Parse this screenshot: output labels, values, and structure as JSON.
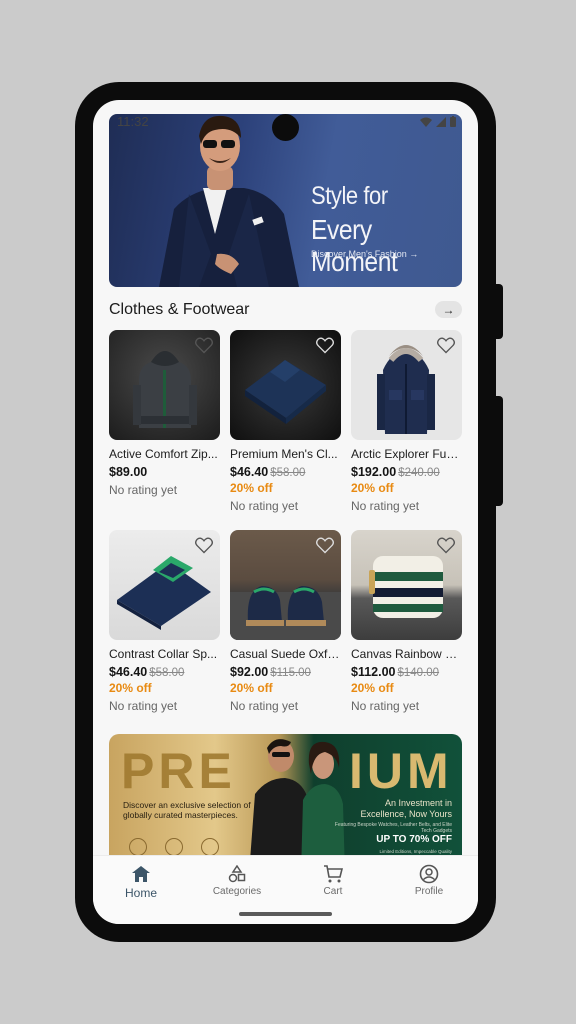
{
  "status": {
    "time": "11:32"
  },
  "hero": {
    "title_line1": "Style for",
    "title_line2": "Every Moment",
    "cta": "Discover Men's Fashion →"
  },
  "section": {
    "title": "Clothes & Footwear",
    "arrow": "→"
  },
  "products": [
    {
      "name": "Active Comfort Zip...",
      "price": "$89.00",
      "old_price": "",
      "discount": "",
      "rating": "No rating yet"
    },
    {
      "name": "Premium Men's Cl...",
      "price": "$46.40",
      "old_price": "$58.00",
      "discount": "20% off",
      "rating": "No rating yet"
    },
    {
      "name": "Arctic Explorer Fur-...",
      "price": "$192.00",
      "old_price": "$240.00",
      "discount": "20% off",
      "rating": "No rating yet"
    },
    {
      "name": "Contrast Collar Sp...",
      "price": "$46.40",
      "old_price": "$58.00",
      "discount": "20% off",
      "rating": "No rating yet"
    },
    {
      "name": "Casual Suede Oxfo...",
      "price": "$92.00",
      "old_price": "$115.00",
      "discount": "20% off",
      "rating": "No rating yet"
    },
    {
      "name": "Canvas Rainbow S...",
      "price": "$112.00",
      "old_price": "$140.00",
      "discount": "20% off",
      "rating": "No rating yet"
    }
  ],
  "premium_banner": {
    "word_left": "PRE",
    "word_right": "IUM",
    "description": "Discover an exclusive selection of globally curated masterpieces.",
    "investment": "An Investment in Excellence, Now Yours",
    "featuring": "Featuring Bespoke Watches, Leather Belts, and Elite Tech Gadgets",
    "offer": "UP TO 70% OFF",
    "limited": "Limited Editions, Impeccable Quality"
  },
  "nav": {
    "items": [
      {
        "label": "Home",
        "icon": "home-icon"
      },
      {
        "label": "Categories",
        "icon": "categories-icon"
      },
      {
        "label": "Cart",
        "icon": "cart-icon"
      },
      {
        "label": "Profile",
        "icon": "profile-icon"
      }
    ],
    "active": "Home"
  },
  "colors": {
    "accent": "#3c5568",
    "discount": "#e88a12",
    "hero_bg": "#2c417a"
  }
}
